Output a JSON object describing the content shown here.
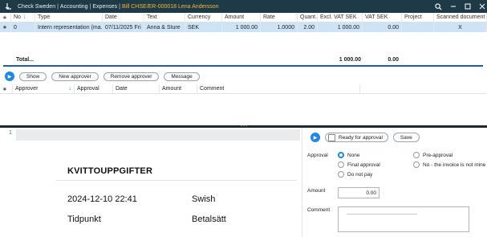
{
  "titlebar": {
    "crumbs": [
      "Check Sweden",
      "Accounting",
      "Expenses"
    ],
    "link": "Bill CHSE/ER-000018 Lena Andersson"
  },
  "grid": {
    "headers": {
      "no": "No",
      "type": "Type",
      "date": "Date",
      "text": "Text",
      "currency": "Currency",
      "amount": "Amount",
      "rate": "Rate",
      "quant": "Quant.",
      "excl": "Excl. VAT SEK",
      "vat": "VAT SEK",
      "project": "Project",
      "scanned": "Scanned document"
    },
    "rows": [
      {
        "no": "0",
        "type": "Intern representation (ma...",
        "date": "07/11/2025 Fri",
        "text": "Anna & Sture",
        "currency": "SEK",
        "amount": "1 000.00",
        "rate": "1.0000",
        "quant": "2.00",
        "excl": "1 000.00",
        "vat": "0.00",
        "project": "",
        "scanned": "X"
      }
    ],
    "totals": {
      "label": "Total...",
      "excl": "1 000.00",
      "vat": "0.00"
    }
  },
  "buttons": {
    "show": "Show",
    "new_approver": "New approver",
    "remove_approver": "Remove approver",
    "message": "Message"
  },
  "approvers": {
    "headers": {
      "approver": "Approver",
      "approval": "Approval",
      "date": "Date",
      "amount": "Amount",
      "comment": "Comment"
    }
  },
  "document": {
    "line_number": "1",
    "title": "KVITTOUPPGIFTER",
    "date_value": "2024-12-10 22:41",
    "payment_value": "Swish",
    "date_label": "Tidpunkt",
    "payment_label": "Betalsätt"
  },
  "approval": {
    "ready_label": "Ready for approval",
    "save_label": "Save",
    "approval_label": "Approval",
    "options": {
      "none": "None",
      "pre": "Pre-approval",
      "final": "Final approval",
      "not_mine": "No - the invoice is not mine",
      "do_not_pay": "Do not pay"
    },
    "selected": "none",
    "amount_label": "Amount",
    "amount_value": "0.00",
    "comment_label": "Comment"
  },
  "colors": {
    "titlebar": "#1e3a47",
    "link": "#f3b83a",
    "selected_row": "#cfe3f6",
    "accent": "#1e88e5",
    "total_line": "#1c5ea8"
  }
}
